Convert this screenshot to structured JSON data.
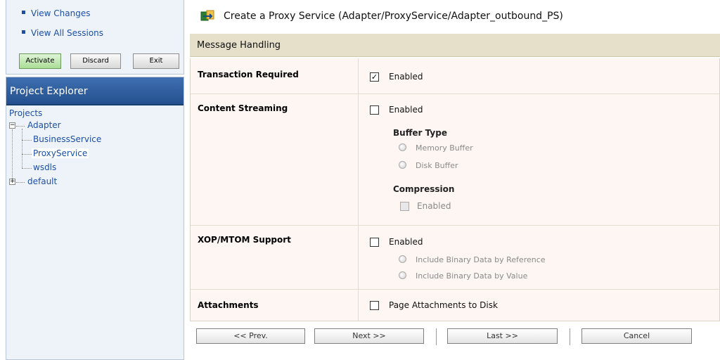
{
  "change_center": {
    "links": [
      "View Changes",
      "View All Sessions"
    ],
    "buttons": {
      "activate": "Activate",
      "discard": "Discard",
      "exit": "Exit"
    }
  },
  "project_explorer": {
    "title": "Project Explorer",
    "tree": {
      "root": "Projects",
      "adapter": "Adapter",
      "children": [
        "BusinessService",
        "ProxyService",
        "wsdls"
      ],
      "default": "default"
    }
  },
  "page": {
    "title": "Create a Proxy Service (Adapter/ProxyService/Adapter_outbound_PS)",
    "section": "Message Handling"
  },
  "form": {
    "transaction": {
      "label": "Transaction Required",
      "option": "Enabled",
      "checked": true
    },
    "content_streaming": {
      "label": "Content Streaming",
      "option": "Enabled",
      "checked": false,
      "buffer_type_label": "Buffer Type",
      "buffer_options": [
        "Memory Buffer",
        "Disk Buffer"
      ],
      "compression_label": "Compression",
      "compression_option": "Enabled"
    },
    "xop": {
      "label": "XOP/MTOM Support",
      "option": "Enabled",
      "checked": false,
      "options": [
        "Include Binary Data by Reference",
        "Include Binary Data by Value"
      ]
    },
    "attachments": {
      "label": "Attachments",
      "option": "Page Attachments to Disk",
      "checked": false
    }
  },
  "nav": {
    "prev": "<< Prev.",
    "next": "Next >>",
    "last": "Last >>",
    "cancel": "Cancel"
  },
  "colors": {
    "header_blue": "#24508e",
    "section_bg": "#e6e0cb",
    "link_blue": "#1c4fa6",
    "form_bg": "#fdf6f2"
  }
}
